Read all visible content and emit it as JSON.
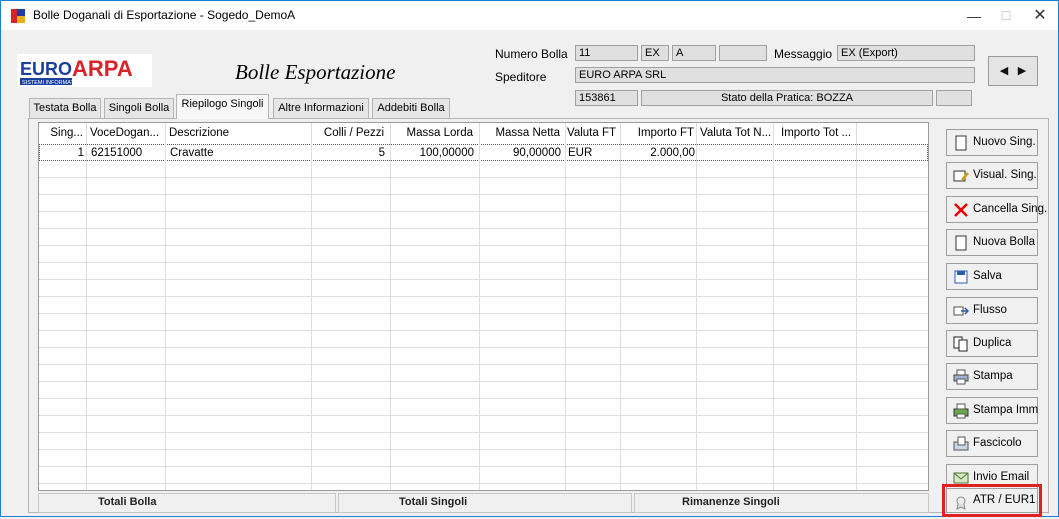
{
  "window": {
    "title": "Bolle Doganali di Esportazione - Sogedo_DemoA",
    "minimize": "—",
    "maximize": "☐",
    "close": "✕"
  },
  "logo": {
    "brand_left": "EURO",
    "brand_right": "ARPA",
    "tagline": "SISTEMI INFORMATICI"
  },
  "module_title": "Bolle Esportazione",
  "header": {
    "numero_bolla_label": "Numero Bolla",
    "numero_bolla": "11",
    "tipo": "EX",
    "sub_tipo": "A",
    "extra": "",
    "messaggio_label": "Messaggio",
    "messaggio": "EX (Export)",
    "speditore_label": "Speditore",
    "speditore": "EURO ARPA SRL",
    "codice": "153861",
    "stato": "Stato della Pratica: BOZZA",
    "stato_extra": ""
  },
  "tabs": [
    "Testata Bolla",
    "Singoli Bolla",
    "Riepilogo Singoli",
    "Altre Informazioni",
    "Addebiti Bolla"
  ],
  "active_tab": 2,
  "table": {
    "columns": [
      "Sing...",
      "VoceDogan...",
      "Descrizione",
      "Colli / Pezzi",
      "Massa Lorda",
      "Massa Netta",
      "Valuta FT",
      "Importo FT",
      "Valuta Tot N...",
      "Importo Tot ..."
    ],
    "rows": [
      [
        "1",
        "62151000",
        "Cravatte",
        "5",
        "100,00000",
        "90,00000",
        "EUR",
        "2.000,00",
        "",
        ""
      ]
    ]
  },
  "totals": {
    "bolla": "Totali Bolla",
    "singoli": "Totali Singoli",
    "rimanenze": "Rimanenze Singoli"
  },
  "side_buttons": [
    {
      "label": "Nuovo Sing.",
      "icon": "document-icon"
    },
    {
      "label": "Visual. Sing.",
      "icon": "view-edit-icon"
    },
    {
      "label": "Cancella Sing.",
      "icon": "delete-x-icon"
    },
    {
      "label": "Nuova Bolla",
      "icon": "document-icon"
    },
    {
      "label": "Salva",
      "icon": "save-icon"
    },
    {
      "label": "Flusso",
      "icon": "flow-icon"
    },
    {
      "label": "Duplica",
      "icon": "duplicate-icon"
    },
    {
      "label": "Stampa",
      "icon": "printer-icon"
    },
    {
      "label": "Stampa Imm",
      "icon": "print-image-icon"
    },
    {
      "label": "Fascicolo",
      "icon": "folder-file-icon"
    },
    {
      "label": "Invio Email",
      "icon": "email-send-icon"
    },
    {
      "label": "ATR / EUR1",
      "icon": "certificate-icon"
    }
  ],
  "colors": {
    "highlight": "#e02020",
    "logo_blue": "#1a3f9c",
    "logo_red": "#d8232a"
  }
}
